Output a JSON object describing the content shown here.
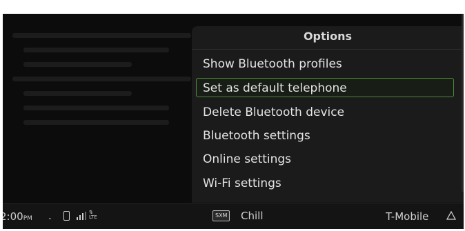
{
  "options_menu": {
    "title": "Options",
    "items": [
      {
        "label": "Show Bluetooth profiles",
        "selected": false
      },
      {
        "label": "Set as default telephone",
        "selected": true
      },
      {
        "label": "Delete Bluetooth device",
        "selected": false
      },
      {
        "label": "Bluetooth settings",
        "selected": false
      },
      {
        "label": "Online settings",
        "selected": false
      },
      {
        "label": "Wi-Fi settings",
        "selected": false
      }
    ]
  },
  "status_bar": {
    "time": "2:00",
    "ampm": "PM",
    "separator": ".",
    "network_type": "LTE",
    "radio_source": "SXM",
    "station": "Chill",
    "carrier": "T-Mobile",
    "icons": [
      "phone-icon",
      "signal-icon",
      "lte-icon",
      "warning-icon"
    ]
  },
  "colors": {
    "background": "#0c0c0c",
    "panel": "#1b1b1b",
    "text": "#e4e4e4",
    "selection_border": "#4e8a3a"
  }
}
